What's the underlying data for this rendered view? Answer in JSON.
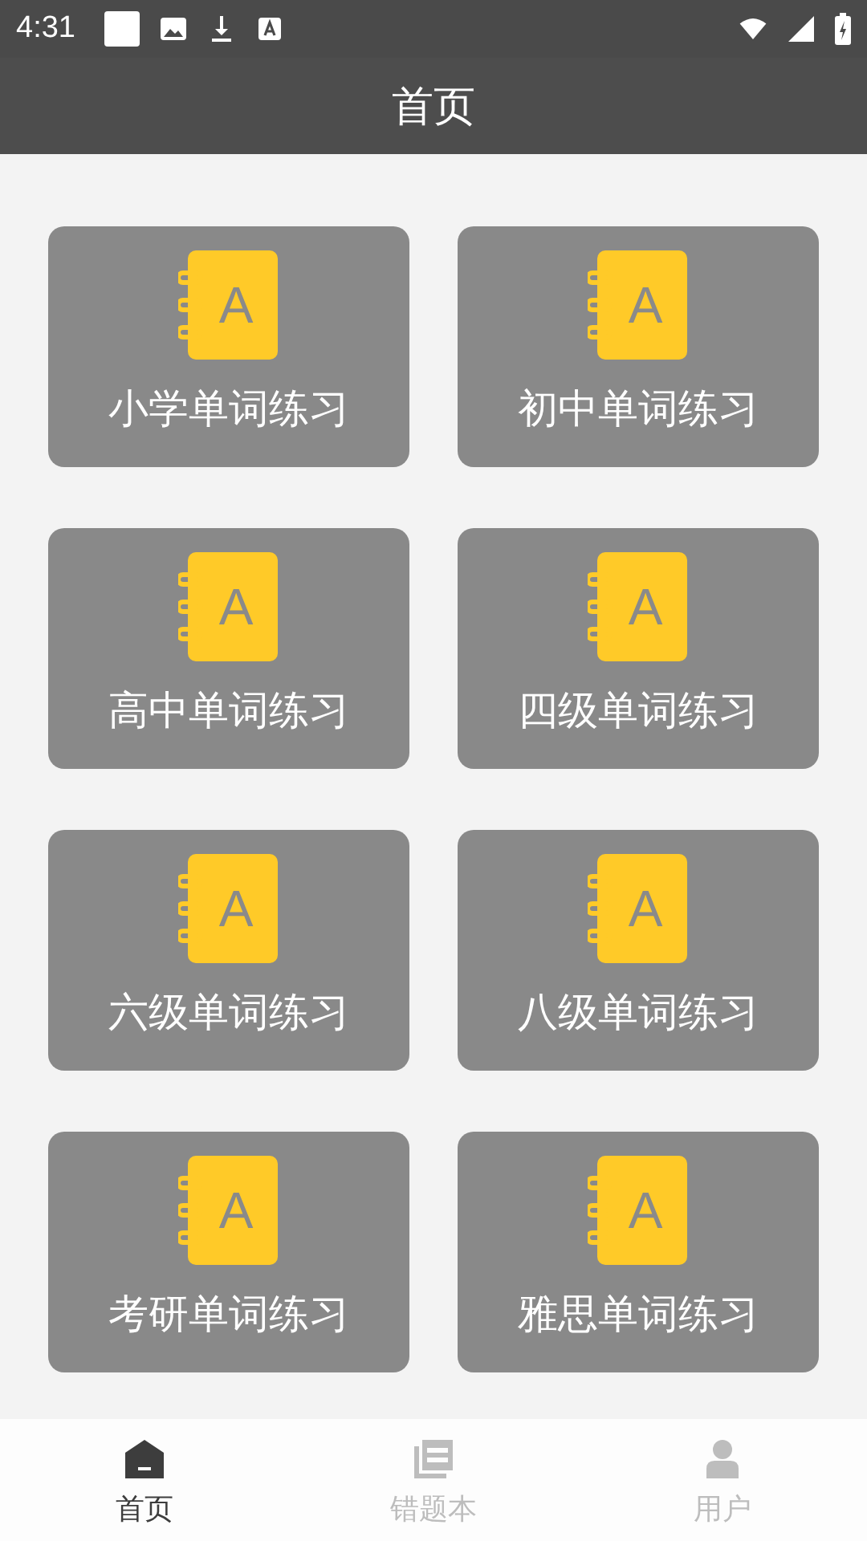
{
  "status_bar": {
    "time": "4:31"
  },
  "header": {
    "title": "首页"
  },
  "cards": [
    {
      "icon_letter": "A",
      "label": "小学单词练习"
    },
    {
      "icon_letter": "A",
      "label": "初中单词练习"
    },
    {
      "icon_letter": "A",
      "label": "高中单词练习"
    },
    {
      "icon_letter": "A",
      "label": "四级单词练习"
    },
    {
      "icon_letter": "A",
      "label": "六级单词练习"
    },
    {
      "icon_letter": "A",
      "label": "八级单词练习"
    },
    {
      "icon_letter": "A",
      "label": "考研单词练习"
    },
    {
      "icon_letter": "A",
      "label": "雅思单词练习"
    }
  ],
  "bottom_nav": [
    {
      "kind": "home",
      "label": "首页",
      "selected": true
    },
    {
      "kind": "notebook",
      "label": "错题本",
      "selected": false
    },
    {
      "kind": "user",
      "label": "用户",
      "selected": false
    }
  ]
}
